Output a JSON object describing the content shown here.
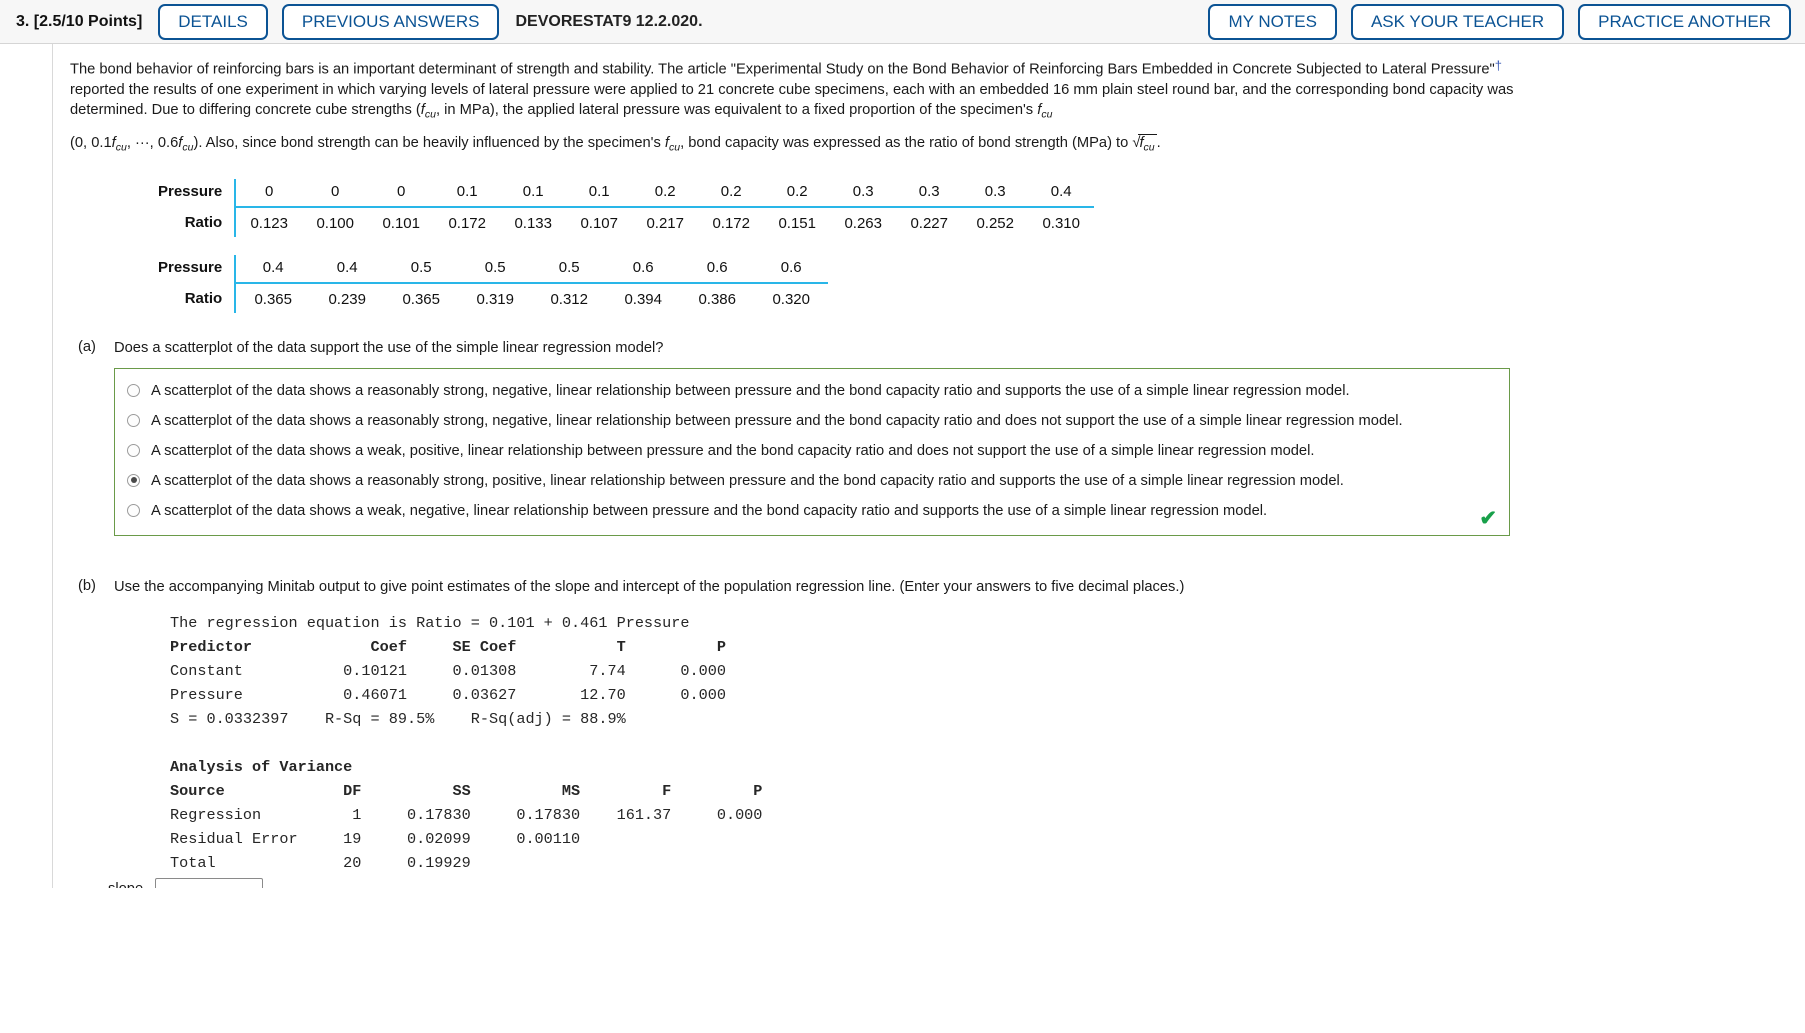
{
  "header": {
    "points": "3.  [2.5/10 Points]",
    "details_label": "DETAILS",
    "previous_answers_label": "PREVIOUS ANSWERS",
    "question_code": "DEVORESTAT9 12.2.020.",
    "my_notes_label": "MY NOTES",
    "ask_teacher_label": "ASK YOUR TEACHER",
    "practice_another_label": "PRACTICE ANOTHER",
    "accent_color": "#0b5394"
  },
  "problem": {
    "line1_a": "The bond behavior of reinforcing bars is an important determinant of strength and stability. The article \"Experimental Study on the Bond Behavior of Reinforcing Bars Embedded in Concrete Subjected to Lateral Pressure\"",
    "dagger": "†",
    "line1_b": " reported the results of one experiment in which varying levels of lateral pressure were applied to 21 concrete cube specimens, each with an embedded 16 mm plain steel round bar, and the corresponding bond capacity was determined. Due to differing concrete cube strengths (",
    "f_sym": "f",
    "cu_sub": "cu",
    "line1_c": ", in MPa), the applied lateral pressure was equivalent to a fixed proportion of the specimen's ",
    "line2_a": "(0, 0.1",
    "line2_b": ", ···, 0.6",
    "line2_c": "). Also, since bond strength can be heavily influenced by the specimen's ",
    "line2_d": ", bond capacity was expressed as the ratio of bond strength (MPa) to ",
    "line2_e": "."
  },
  "table1": {
    "row_label_pressure": "Pressure",
    "row_label_ratio": "Ratio",
    "pressure": [
      "0",
      "0",
      "0",
      "0.1",
      "0.1",
      "0.1",
      "0.2",
      "0.2",
      "0.2",
      "0.3",
      "0.3",
      "0.3",
      "0.4"
    ],
    "ratio": [
      "0.123",
      "0.100",
      "0.101",
      "0.172",
      "0.133",
      "0.107",
      "0.217",
      "0.172",
      "0.151",
      "0.263",
      "0.227",
      "0.252",
      "0.310"
    ]
  },
  "table2": {
    "row_label_pressure": "Pressure",
    "row_label_ratio": "Ratio",
    "pressure": [
      "0.4",
      "0.4",
      "0.5",
      "0.5",
      "0.5",
      "0.6",
      "0.6",
      "0.6"
    ],
    "ratio": [
      "0.365",
      "0.239",
      "0.365",
      "0.319",
      "0.312",
      "0.394",
      "0.386",
      "0.320"
    ]
  },
  "part_a": {
    "label": "(a)",
    "question": "Does a scatterplot of the data support the use of the simple linear regression model?",
    "options": [
      {
        "text": "A scatterplot of the data shows a reasonably strong, negative, linear relationship between pressure and the bond capacity ratio and supports the use of a simple linear regression model.",
        "selected": false
      },
      {
        "text": "A scatterplot of the data shows a reasonably strong, negative, linear relationship between pressure and the bond capacity ratio and does not support the use of a simple linear regression model.",
        "selected": false
      },
      {
        "text": "A scatterplot of the data shows a weak, positive, linear relationship between pressure and the bond capacity ratio and does not support the use of a simple linear regression model.",
        "selected": false
      },
      {
        "text": "A scatterplot of the data shows a reasonably strong, positive, linear relationship between pressure and the bond capacity ratio and supports the use of a simple linear regression model.",
        "selected": true
      },
      {
        "text": "A scatterplot of the data shows a weak, negative, linear relationship between pressure and the bond capacity ratio and supports the use of a simple linear regression model.",
        "selected": false
      }
    ],
    "correct_mark": "✔",
    "correct_color": "#18a04a",
    "box_border_color": "#6a9a49"
  },
  "part_b": {
    "label": "(b)",
    "question": "Use the accompanying Minitab output to give point estimates of the slope and intercept of the population regression line. (Enter your answers to five decimal places.)",
    "minitab": {
      "equation": "The regression equation is Ratio = 0.101 + 0.461 Pressure",
      "header1": "Predictor             Coef     SE Coef           T          P",
      "row_constant": "Constant           0.10121     0.01308        7.74      0.000",
      "row_pressure": "Pressure           0.46071     0.03627       12.70      0.000",
      "row_s": "S = 0.0332397    R-Sq = 89.5%    R-Sq(adj) = 88.9%",
      "anova_title": "Analysis of Variance",
      "header2": "Source             DF          SS          MS         F         P",
      "row_regression": "Regression          1     0.17830     0.17830    161.37     0.000",
      "row_residual": "Residual Error     19     0.02099     0.00110",
      "row_total": "Total              20     0.19929"
    },
    "slope_label": "slope",
    "slope_value": ""
  }
}
